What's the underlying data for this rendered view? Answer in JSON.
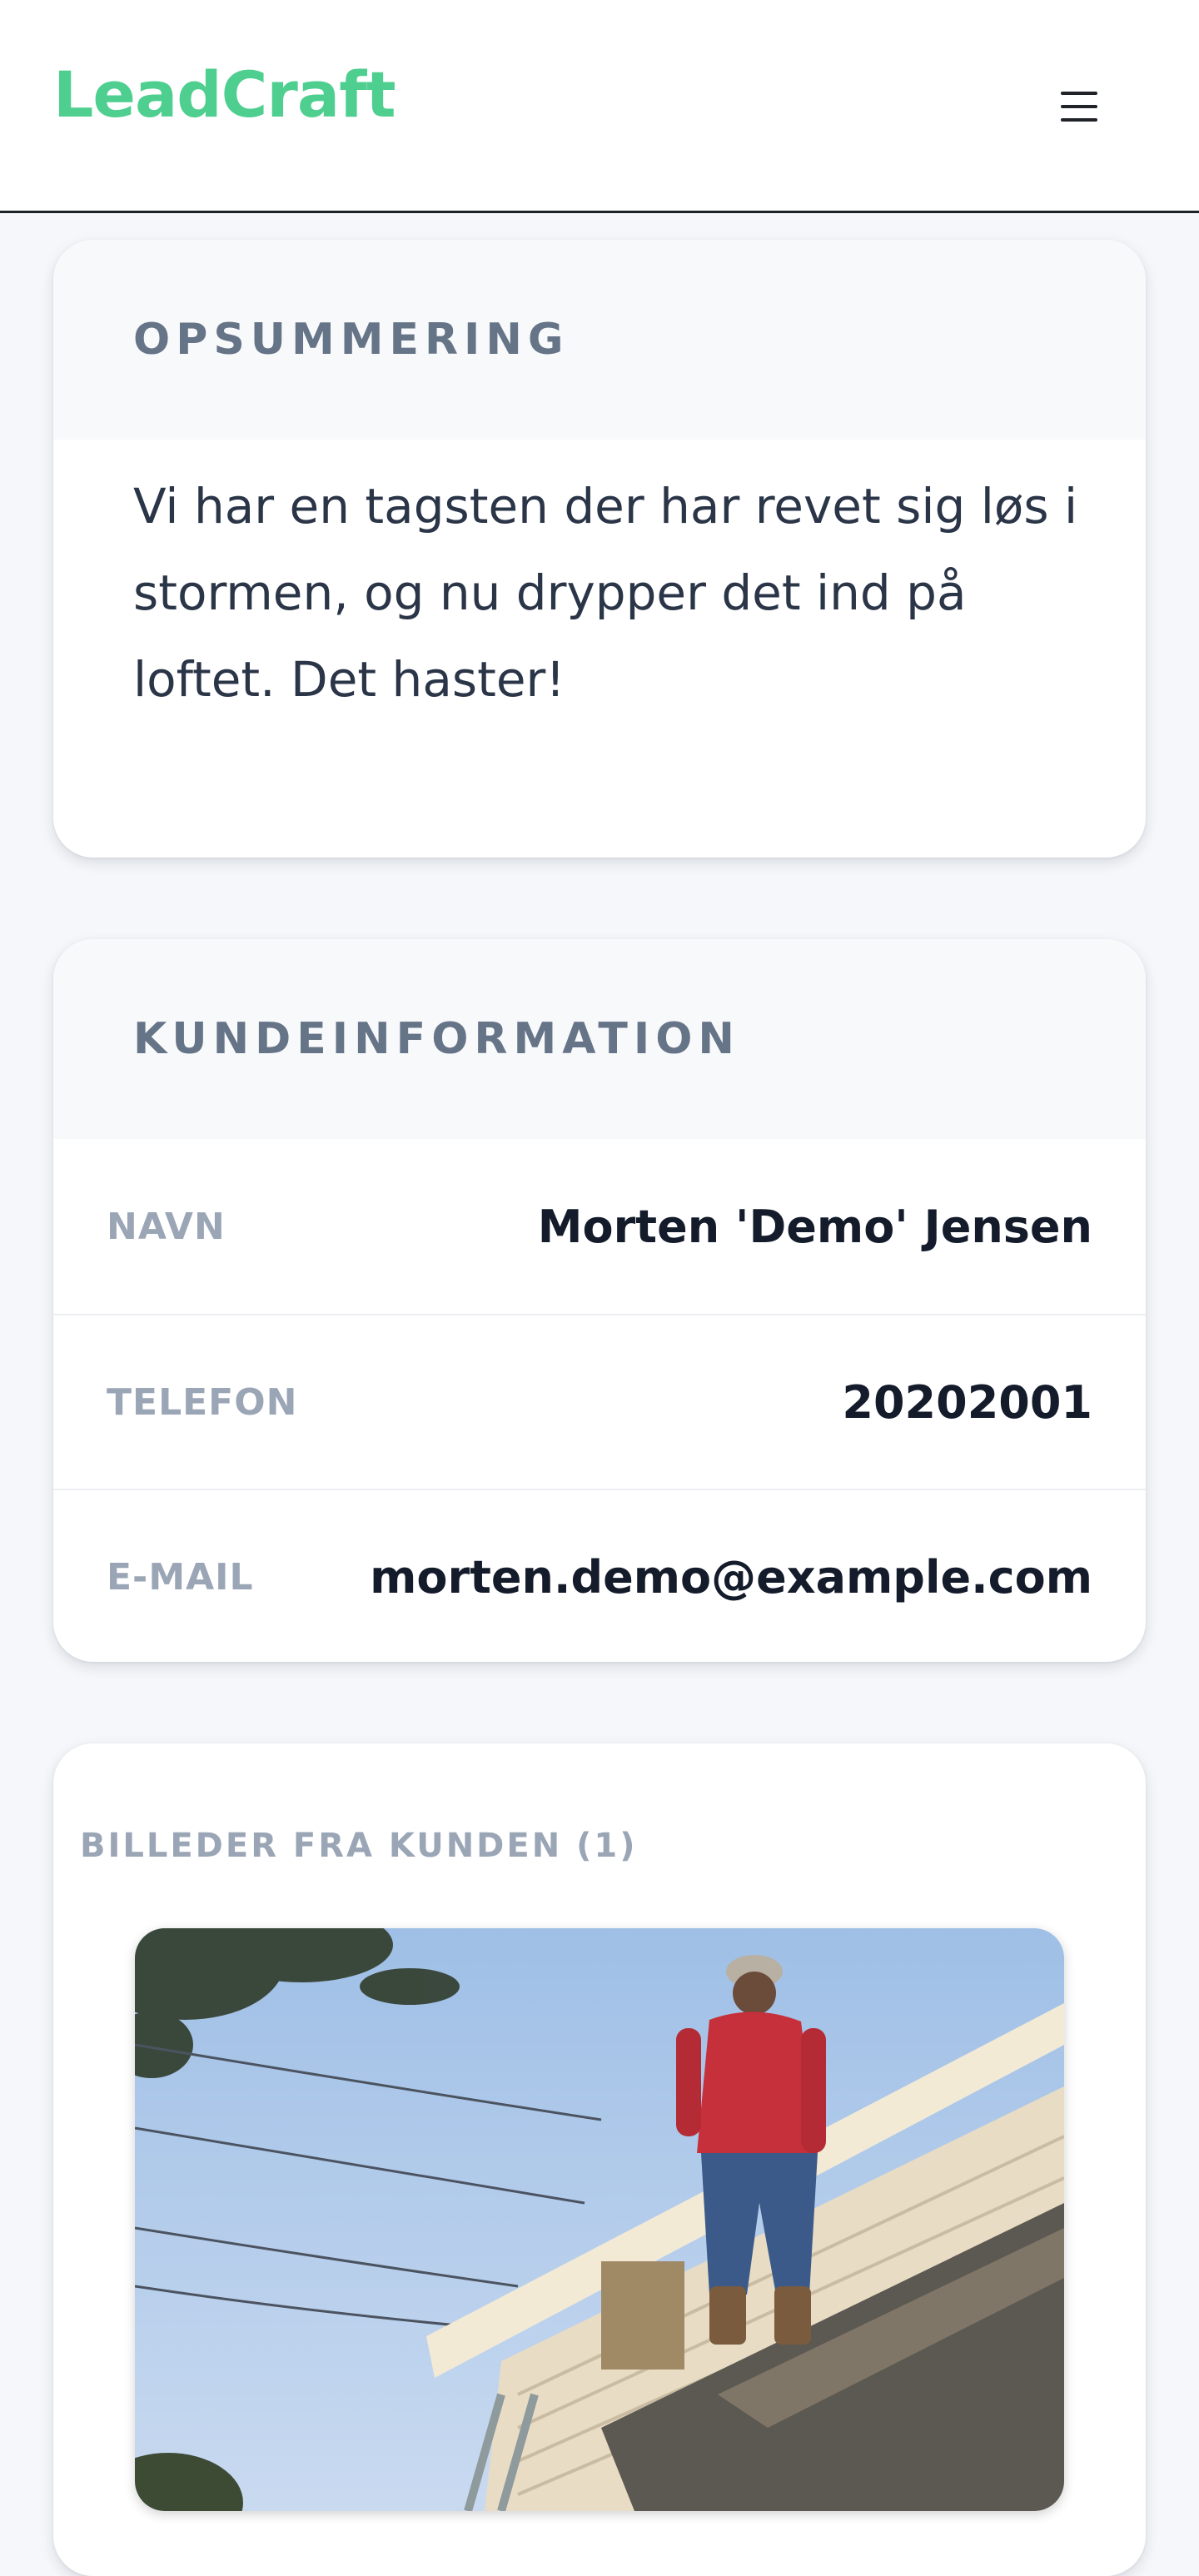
{
  "header": {
    "logo": "LeadCraft",
    "brand_color": "#4ecf8f",
    "menu_icon": "hamburger-menu-icon"
  },
  "summary": {
    "heading": "OPSUMMERING",
    "text": "Vi har en tagsten der har revet sig løs i stormen, og nu drypper det ind på loftet. Det haster!"
  },
  "customer": {
    "heading": "KUNDEINFORMATION",
    "rows": [
      {
        "label": "NAVN",
        "value": "Morten 'Demo' Jensen"
      },
      {
        "label": "TELEFON",
        "value": "20202001"
      },
      {
        "label": "E-MAIL",
        "value": "morten.demo@example.com"
      }
    ]
  },
  "photos": {
    "heading": "BILLEDER FRA KUNDEN (1)",
    "items": [
      {
        "icon": "customer-photo-roof"
      }
    ]
  }
}
